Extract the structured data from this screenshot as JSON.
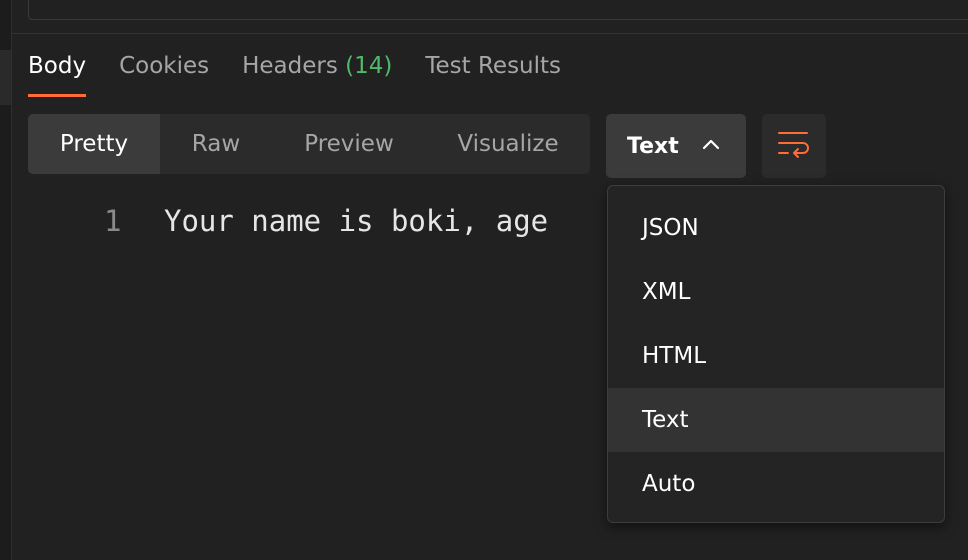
{
  "response_tabs": {
    "body": "Body",
    "cookies": "Cookies",
    "headers": "Headers",
    "headers_count": "(14)",
    "test_results": "Test Results"
  },
  "view_modes": {
    "pretty": "Pretty",
    "raw": "Raw",
    "preview": "Preview",
    "visualize": "Visualize"
  },
  "format_select": {
    "value": "Text",
    "options": [
      "JSON",
      "XML",
      "HTML",
      "Text",
      "Auto"
    ]
  },
  "editor": {
    "line_number": "1",
    "line_text": "Your name is boki, age"
  },
  "colors": {
    "accent": "#ff6c37",
    "count_green": "#4fb86a",
    "background": "#212121"
  },
  "icons": {
    "chevron": "chevron-up-icon",
    "wrap": "wrap-lines-icon"
  }
}
